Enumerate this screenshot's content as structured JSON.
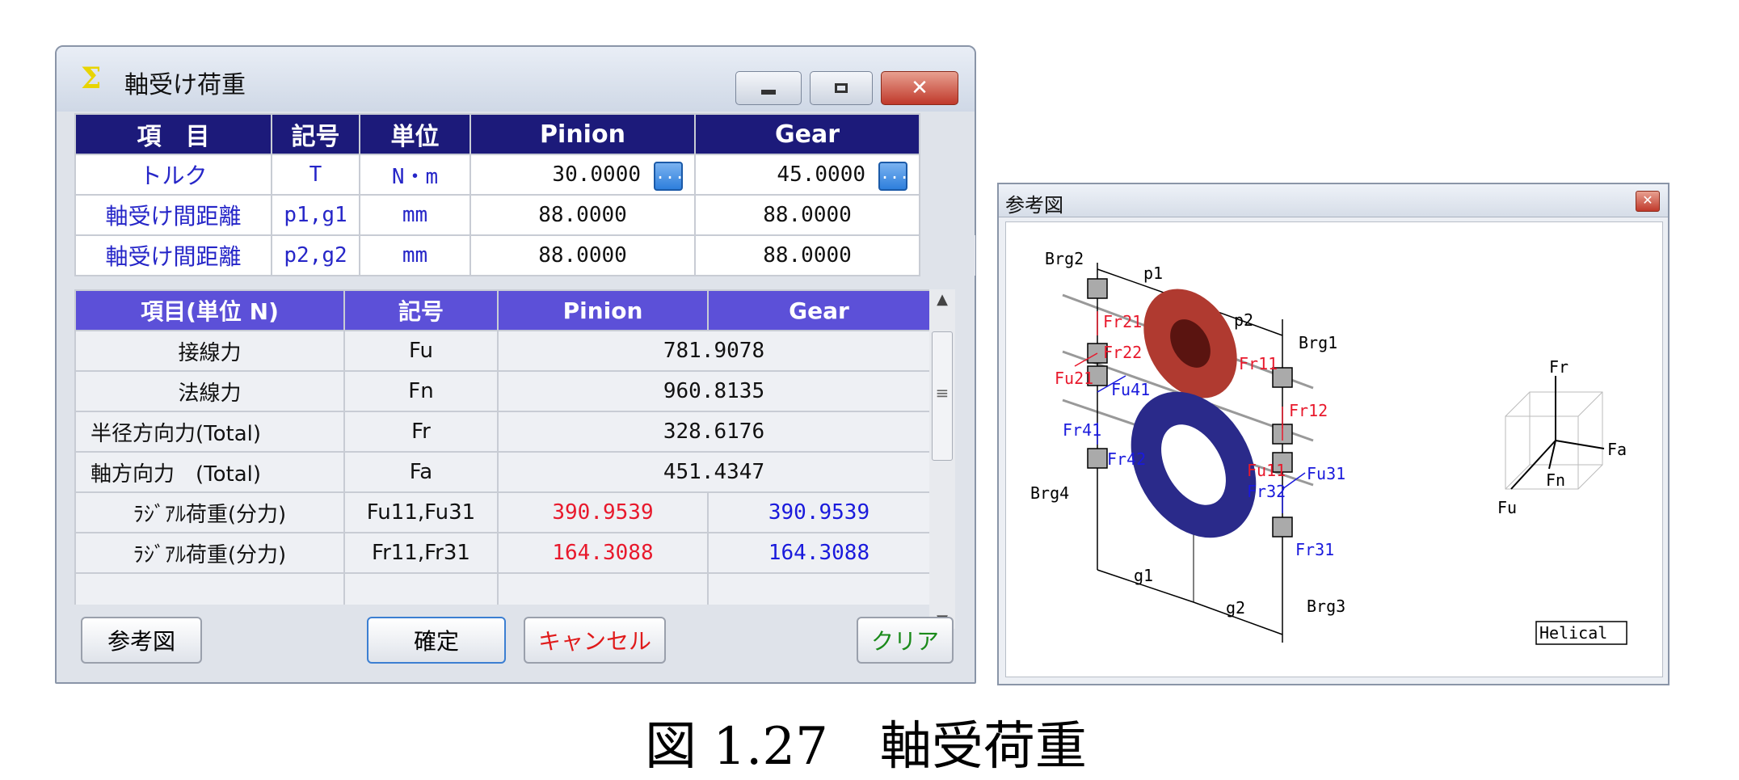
{
  "dialog": {
    "title": "軸受け荷重",
    "icon": "sigma-icon",
    "buttons": {
      "minimize": "minimize-icon",
      "maximize": "maximize-icon",
      "close": "close-icon"
    }
  },
  "table1": {
    "headers": [
      "項　目",
      "記号",
      "単位",
      "Pinion",
      "Gear"
    ],
    "rows": [
      {
        "label": "トルク",
        "symbol": "T",
        "unit": "N・m",
        "pinion": "30.0000",
        "gear": "45.0000"
      },
      {
        "label": "軸受け間距離",
        "symbol": "p1,g1",
        "unit": "mm",
        "pinion": "88.0000",
        "gear": "88.0000"
      },
      {
        "label": "軸受け間距離",
        "symbol": "p2,g2",
        "unit": "mm",
        "pinion": "88.0000",
        "gear": "88.0000"
      }
    ],
    "ellipsis": "..."
  },
  "table2": {
    "headers": [
      "項目(単位 N)",
      "記号",
      "Pinion",
      "Gear"
    ],
    "merged_rows": [
      {
        "label": "接線力",
        "symbol": "Fu",
        "value": "781.9078"
      },
      {
        "label": "法線力",
        "symbol": "Fn",
        "value": "960.8135"
      },
      {
        "label": "半径方向力(Total)",
        "symbol": "Fr",
        "value": "328.6176"
      },
      {
        "label": "軸方向力　(Total)",
        "symbol": "Fa",
        "value": "451.4347"
      }
    ],
    "split_rows": [
      {
        "label": "ﾗｼﾞｱﾙ荷重(分力)",
        "symbol": "Fu11,Fu31",
        "pinion": "390.9539",
        "gear": "390.9539"
      },
      {
        "label": "ﾗｼﾞｱﾙ荷重(分力)",
        "symbol": "Fr11,Fr31",
        "pinion": "164.3088",
        "gear": "164.3088"
      }
    ]
  },
  "buttons": {
    "reference": "参考図",
    "confirm": "確定",
    "cancel": "キャンセル",
    "clear": "クリア"
  },
  "colors": {
    "header_dark": "#1c1a7a",
    "header_light": "#5c50d8",
    "pinion_value": "#e8192c",
    "gear_value": "#1a1adc",
    "label_blue": "#2626c8"
  },
  "reference_window": {
    "title": "参考図",
    "labels": {
      "brg1": "Brg1",
      "brg2": "Brg2",
      "brg3": "Brg3",
      "brg4": "Brg4",
      "p1": "p1",
      "p2": "p2",
      "g1": "g1",
      "g2": "g2",
      "fr21": "Fr21",
      "fr22": "Fr22",
      "fu21": "Fu21",
      "fu41": "Fu41",
      "fr41": "Fr41",
      "fr42": "Fr42",
      "fr11": "Fr11",
      "fr12": "Fr12",
      "fu11": "Fu11",
      "fr32": "Fr32",
      "fu31": "Fu31",
      "fr31": "Fr31",
      "axis_fr": "Fr",
      "axis_fa": "Fa",
      "axis_fn": "Fn",
      "axis_fu": "Fu",
      "type": "Helical"
    }
  },
  "caption": "図 1.27　軸受荷重"
}
